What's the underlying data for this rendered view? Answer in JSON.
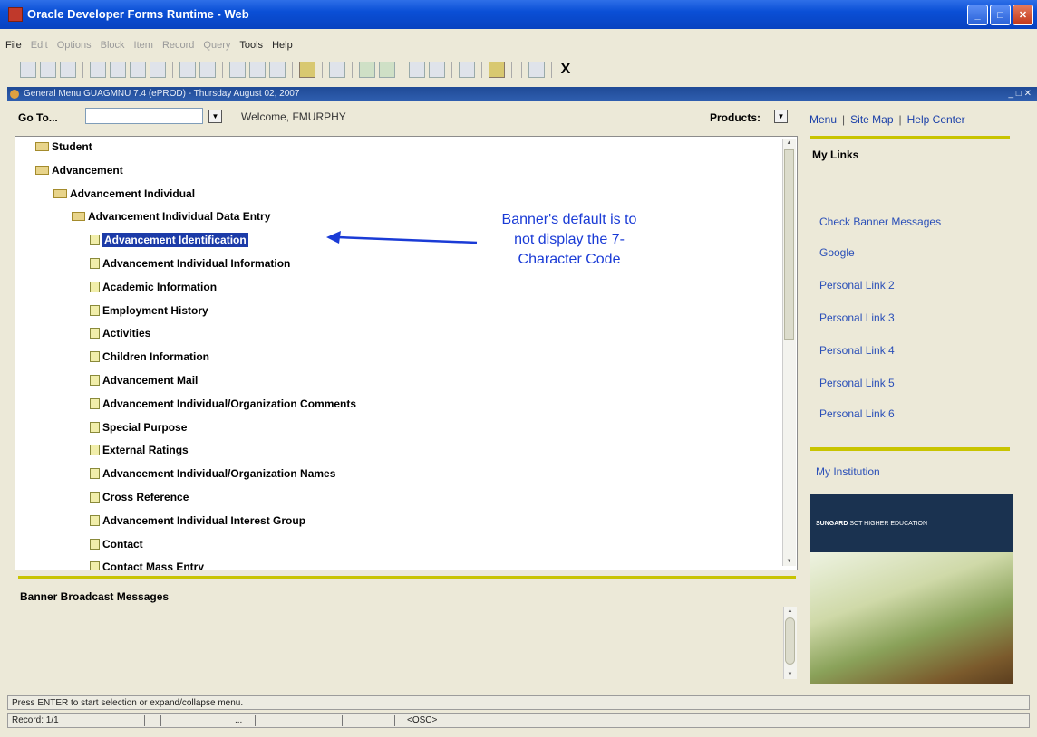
{
  "window": {
    "title": "Oracle Developer Forms Runtime - Web"
  },
  "menubar": [
    {
      "label": "File",
      "enabled": true
    },
    {
      "label": "Edit",
      "enabled": false
    },
    {
      "label": "Options",
      "enabled": false
    },
    {
      "label": "Block",
      "enabled": false
    },
    {
      "label": "Item",
      "enabled": false
    },
    {
      "label": "Record",
      "enabled": false
    },
    {
      "label": "Query",
      "enabled": false
    },
    {
      "label": "Tools",
      "enabled": true
    },
    {
      "label": "Help",
      "enabled": true
    }
  ],
  "toolbar": {
    "exit_label": "X"
  },
  "inner_window": {
    "title": "General Menu  GUAGMNU  7.4  (ePROD) - Thursday August 02, 2007"
  },
  "goto": {
    "label": "Go To...",
    "value": ""
  },
  "welcome": "Welcome, FMURPHY",
  "products": {
    "label": "Products:"
  },
  "top_links": [
    "Menu",
    "Site Map",
    "Help Center"
  ],
  "tree": [
    {
      "label": "Student",
      "type": "folder"
    },
    {
      "label": "Advancement",
      "type": "folder"
    },
    {
      "label": "Advancement Individual",
      "type": "folder"
    },
    {
      "label": "Advancement Individual Data Entry",
      "type": "folder"
    },
    {
      "label": "Advancement Identification",
      "type": "form",
      "selected": true
    },
    {
      "label": "Advancement Individual Information",
      "type": "form"
    },
    {
      "label": "Academic Information",
      "type": "form"
    },
    {
      "label": "Employment History",
      "type": "form"
    },
    {
      "label": "Activities",
      "type": "form"
    },
    {
      "label": "Children Information",
      "type": "form"
    },
    {
      "label": "Advancement Mail",
      "type": "form"
    },
    {
      "label": "Advancement Individual/Organization Comments",
      "type": "form"
    },
    {
      "label": "Special Purpose",
      "type": "form"
    },
    {
      "label": "External Ratings",
      "type": "form"
    },
    {
      "label": "Advancement Individual/Organization Names",
      "type": "form"
    },
    {
      "label": "Cross Reference",
      "type": "form"
    },
    {
      "label": "Advancement Individual Interest Group",
      "type": "form"
    },
    {
      "label": "Contact",
      "type": "form"
    },
    {
      "label": "Contact Mass Entry",
      "type": "form"
    }
  ],
  "annotation": {
    "lines": [
      "Banner's default is to",
      "not display the 7-",
      "Character Code"
    ]
  },
  "broadcast": {
    "title": "Banner Broadcast Messages"
  },
  "my_links": {
    "title": "My Links",
    "links": [
      "Check Banner Messages",
      "Google",
      "Personal Link 2",
      "Personal Link 3",
      "Personal Link 4",
      "Personal Link 5",
      "Personal Link 6"
    ]
  },
  "my_institution": "My Institution",
  "banner_image": {
    "caption_bold": "SUNGARD",
    "caption": "SCT HIGHER EDUCATION"
  },
  "status": {
    "hint": "Press ENTER to start selection or expand/collapse menu.",
    "record": "Record: 1/1",
    "field3": "...",
    "mode": "<OSC>"
  },
  "colors": {
    "selection": "#1c3ba8",
    "accent_rule": "#c8c400",
    "link": "#2a4fb8",
    "annotation": "#1a3bd6"
  }
}
